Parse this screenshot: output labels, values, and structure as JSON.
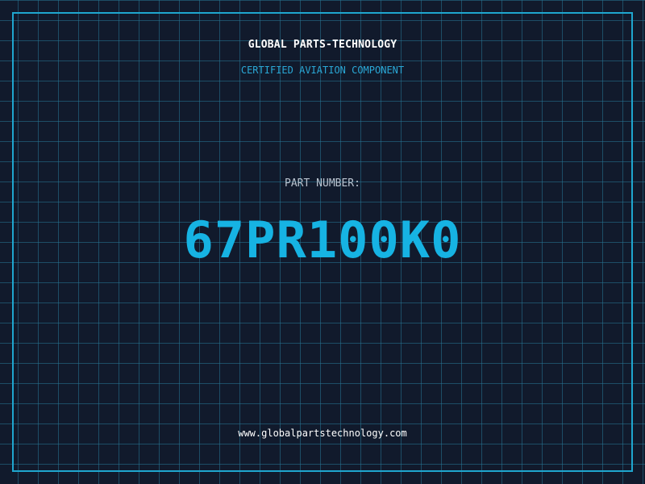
{
  "header": {
    "company": "GLOBAL PARTS-TECHNOLOGY",
    "tagline": "CERTIFIED AVIATION COMPONENT"
  },
  "part": {
    "label": "PART NUMBER:",
    "number": "67PR100K0"
  },
  "footer": {
    "website": "www.globalpartstechnology.com"
  },
  "colors": {
    "background": "#111a2c",
    "grid": "#267696",
    "accent": "#16b3e3",
    "border": "#1fa6cf"
  }
}
